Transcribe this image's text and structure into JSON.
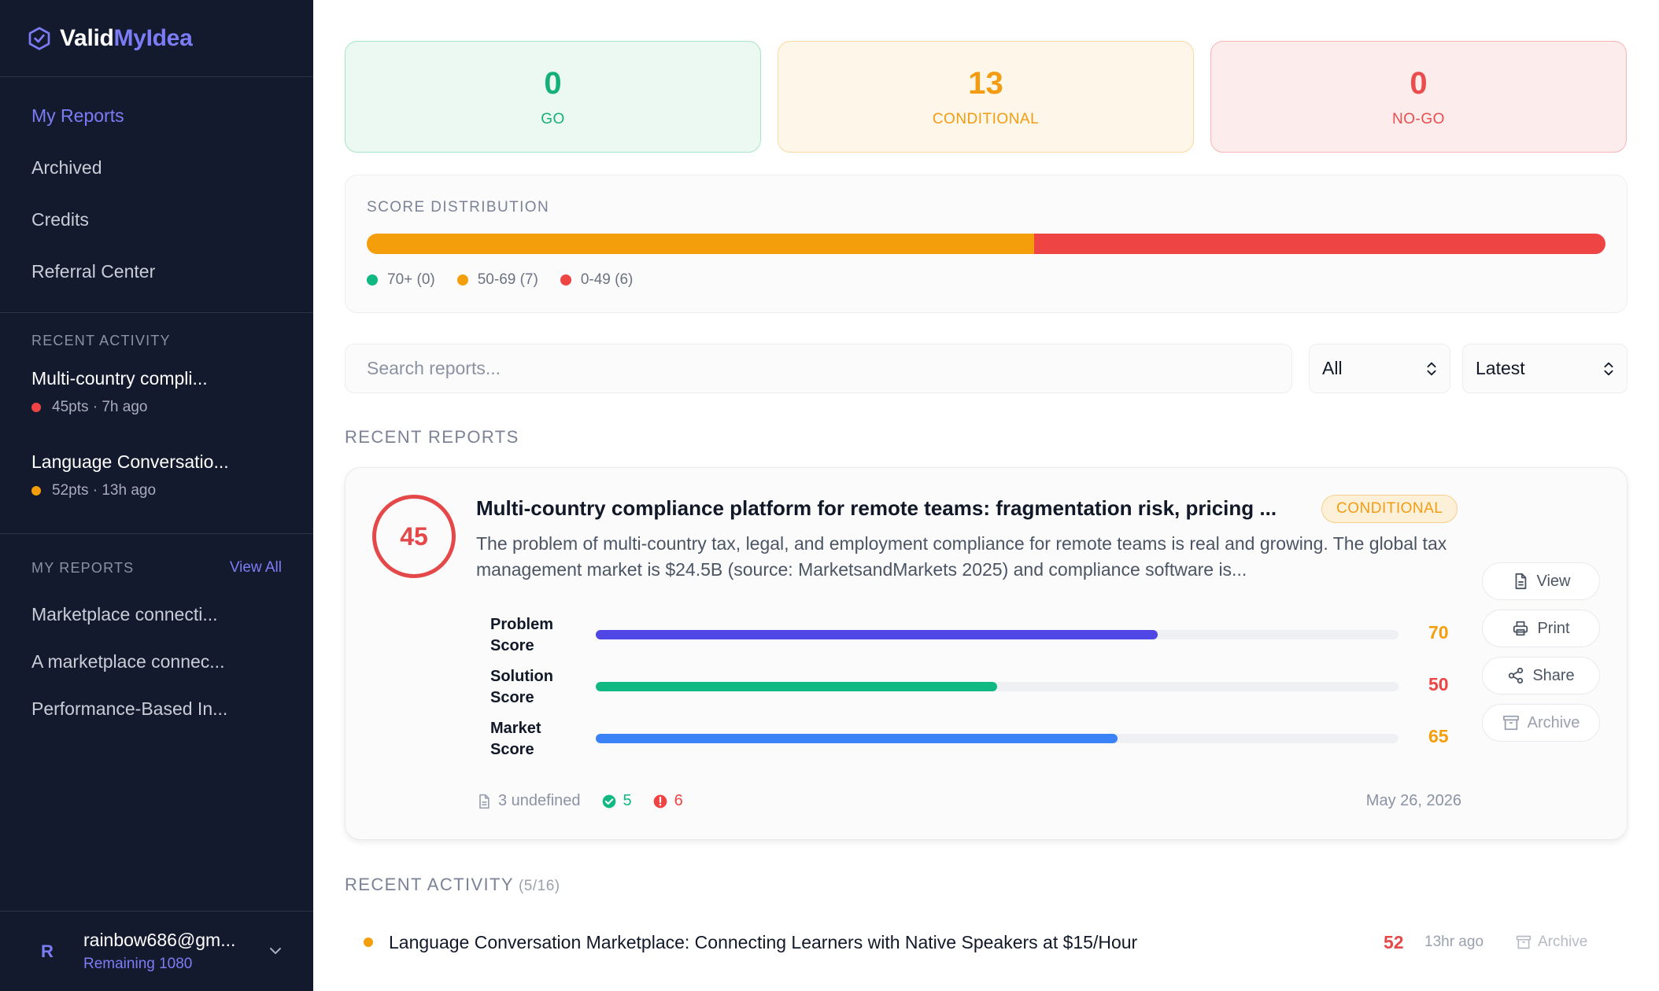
{
  "brand": {
    "name_a": "Valid",
    "name_b": "MyIdea",
    "icon": "hexagon-check-icon"
  },
  "nav": [
    {
      "label": "My Reports",
      "active": true
    },
    {
      "label": "Archived",
      "active": false
    },
    {
      "label": "Credits",
      "active": false
    },
    {
      "label": "Referral Center",
      "active": false
    }
  ],
  "sidebar_activity": {
    "title": "RECENT ACTIVITY",
    "items": [
      {
        "title": "Multi-country compli...",
        "meta": "45pts · 7h ago",
        "color": "#ef4444"
      },
      {
        "title": "Language Conversatio...",
        "meta": "52pts · 13h ago",
        "color": "#f59e0b"
      }
    ]
  },
  "sidebar_reports": {
    "title": "MY REPORTS",
    "view_all": "View All",
    "items": [
      "Marketplace connecti...",
      "A marketplace connec...",
      "Performance-Based In..."
    ]
  },
  "user": {
    "initial": "R",
    "email": "rainbow686@gm...",
    "remaining": "Remaining 1080"
  },
  "stats": {
    "go": {
      "value": "0",
      "label": "GO"
    },
    "conditional": {
      "value": "13",
      "label": "CONDITIONAL"
    },
    "nogo": {
      "value": "0",
      "label": "NO-GO"
    }
  },
  "distribution": {
    "title": "SCORE DISTRIBUTION",
    "segments": [
      {
        "label": "70+ (0)",
        "count": 0,
        "color": "#10b981"
      },
      {
        "label": "50-69 (7)",
        "count": 7,
        "color": "#f59e0b"
      },
      {
        "label": "0-49 (6)",
        "count": 6,
        "color": "#ef4444"
      }
    ]
  },
  "search": {
    "placeholder": "Search reports..."
  },
  "filters": {
    "status": "All",
    "sort": "Latest"
  },
  "recent_reports_title": "RECENT REPORTS",
  "report": {
    "score": "45",
    "title": "Multi-country compliance platform for remote teams: fragmentation risk, pricing ...",
    "badge": "CONDITIONAL",
    "description": "The problem of multi-country tax, legal, and employment compliance for remote teams is real and growing. The global tax management market is $24.5B (source: MarketsandMarkets 2025) and compliance software is...",
    "metrics": [
      {
        "label": "Problem Score",
        "value": 70,
        "display": "70",
        "bar_color": "#4f46e5",
        "value_color": "#f59e0b"
      },
      {
        "label": "Solution Score",
        "value": 50,
        "display": "50",
        "bar_color": "#10b981",
        "value_color": "#ef4444"
      },
      {
        "label": "Market Score",
        "value": 65,
        "display": "65",
        "bar_color": "#3b82f6",
        "value_color": "#f59e0b"
      }
    ],
    "footer": {
      "docs": "3 undefined",
      "pass": "5",
      "fail": "6"
    },
    "date": "May 26, 2026",
    "actions": {
      "view": "View",
      "print": "Print",
      "share": "Share",
      "archive": "Archive"
    }
  },
  "recent_activity": {
    "title": "RECENT ACTIVITY",
    "count": "(5/16)",
    "items": [
      {
        "title": "Language Conversation Marketplace: Connecting Learners with Native Speakers at $15/Hour",
        "score": "52",
        "time": "13hr ago",
        "archive": "Archive",
        "color": "#f59e0b"
      }
    ]
  }
}
